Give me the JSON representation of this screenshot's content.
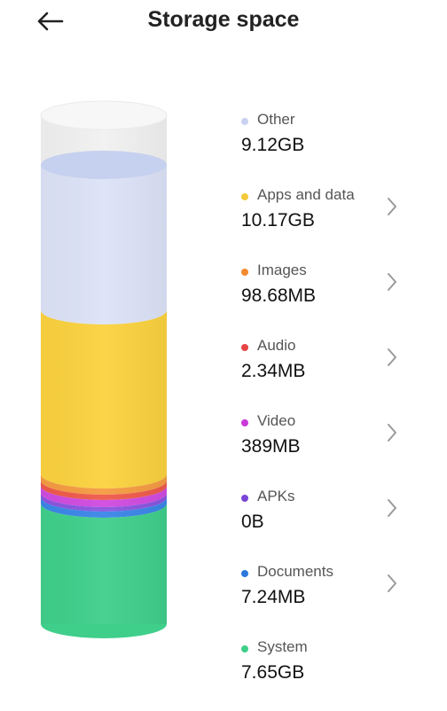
{
  "header": {
    "title": "Storage space",
    "back_icon": "back-arrow-icon"
  },
  "items": [
    {
      "label": "Other",
      "value": "9.12GB",
      "color": "#c9d2f0",
      "has_chevron": false
    },
    {
      "label": "Apps and data",
      "value": "10.17GB",
      "color": "#f6c93b",
      "has_chevron": true
    },
    {
      "label": "Images",
      "value": "98.68MB",
      "color": "#f28a2e",
      "has_chevron": true
    },
    {
      "label": "Audio",
      "value": "2.34MB",
      "color": "#e84545",
      "has_chevron": true
    },
    {
      "label": "Video",
      "value": "389MB",
      "color": "#c93ad8",
      "has_chevron": true
    },
    {
      "label": "APKs",
      "value": "0B",
      "color": "#7a46d6",
      "has_chevron": true
    },
    {
      "label": "Documents",
      "value": "7.24MB",
      "color": "#2a78dc",
      "has_chevron": true
    },
    {
      "label": "System",
      "value": "7.65GB",
      "color": "#3ecf8a",
      "has_chevron": false
    }
  ],
  "cylinder_colors": {
    "empty": "#f2f2f2",
    "other": "#dde3f7",
    "apps": "#fbd23f",
    "images": "#f49a3e",
    "audio": "#ef5a4b",
    "video": "#d04be0",
    "apks": "#8a55e0",
    "documents": "#3b86e8",
    "system": "#3fcf8b"
  }
}
